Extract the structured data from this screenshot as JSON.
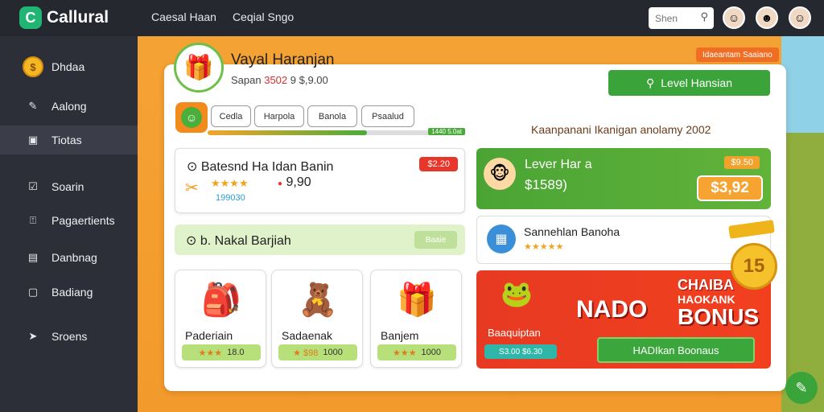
{
  "app": {
    "logo_mark": "C",
    "name": "Callural"
  },
  "topnav": {
    "items": [
      "Caesal Haan",
      "Ceqial Sngo"
    ]
  },
  "search": {
    "placeholder": "Shen",
    "icon": "search-icon"
  },
  "sidebar": {
    "items": [
      {
        "label": "Dhdaa",
        "icon": "coin-icon"
      },
      {
        "label": "Aalong",
        "icon": "tag-icon"
      },
      {
        "label": "Tiotas",
        "icon": "gift-icon"
      },
      {
        "label": "Soarin",
        "icon": "check-box-icon"
      },
      {
        "label": "Pagaertients",
        "icon": "upload-box-icon"
      },
      {
        "label": "Danbnag",
        "icon": "inbox-icon"
      },
      {
        "label": "Badiang",
        "icon": "square-icon"
      },
      {
        "label": "Sroens",
        "icon": "send-icon"
      }
    ]
  },
  "hero": {
    "title": "Vayal Haranjan",
    "subtitle_label": "Sapan",
    "subtitle_value": "3502",
    "subtitle_suffix": "9 $,9.00"
  },
  "promo_tag": "Idaeantam Saaiano",
  "level_button": "Level Hansian",
  "campaign_text": "Kaanpanani Ikanigan anolamy 2002",
  "tabs": [
    "Cedla",
    "Harpola",
    "Banola",
    "Psaalud"
  ],
  "progress": {
    "value": 0.62,
    "label": "1440 5.0at"
  },
  "panel1": {
    "title": "Batesnd Ha Idan Banin",
    "price": "$2.20",
    "stars": "★★★★",
    "rating": "9,90",
    "count": "199030"
  },
  "panel2": {
    "title": "b. Nakal Barjiah",
    "button": "Baaie"
  },
  "items": [
    {
      "name": "Paderiain",
      "stars": "★★★",
      "price": "18.0"
    },
    {
      "name": "Sadaenak",
      "stars": "★ $98",
      "price": "1000"
    },
    {
      "name": "Banjem",
      "stars": "★★★",
      "price": "1000"
    }
  ],
  "lever": {
    "title": "Lever Har a",
    "subtitle": "$1589)",
    "tag": "$9.50",
    "amount": "$3,92"
  },
  "sanne": {
    "title": "Sannehlan Banoha",
    "stars": "★★★★★"
  },
  "bonus": {
    "label": "Baaquiptan",
    "pill": "S3.00 $6.30",
    "nado": "NADO",
    "line1": "CHAIBA",
    "line2": "HAOKANK",
    "line3": "BONUS",
    "coin": "15",
    "cta": "HADIkan Boonaus"
  },
  "colors": {
    "accent_green": "#3aa33a",
    "accent_orange": "#f39a2c",
    "accent_red": "#e73a22"
  }
}
